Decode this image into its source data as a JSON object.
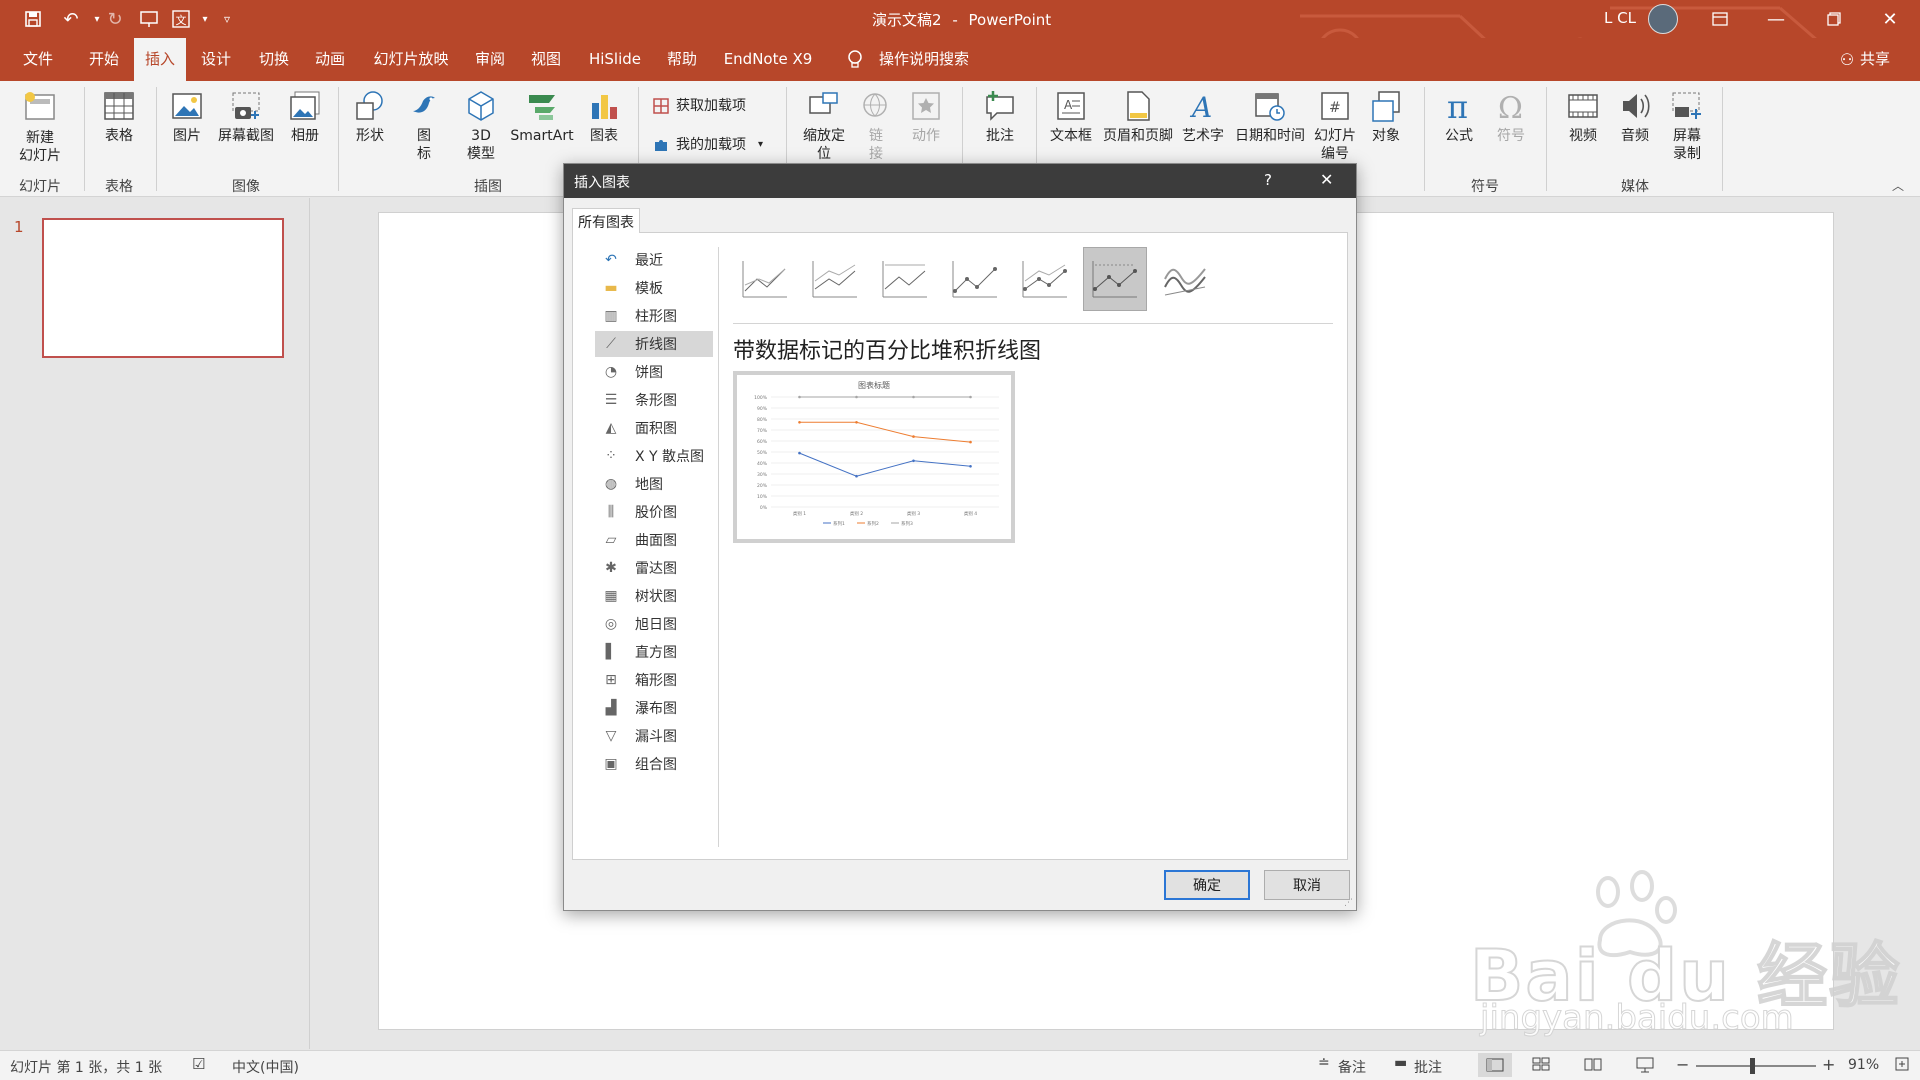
{
  "app": {
    "doc_title": "演示文稿2",
    "separator": "-",
    "app_name": "PowerPoint",
    "user": "L CL",
    "qat_icons": [
      "save-icon",
      "undo-icon",
      "redo-icon",
      "present-icon",
      "translate-icon",
      "customize-icon"
    ]
  },
  "tabs": [
    "文件",
    "开始",
    "插入",
    "设计",
    "切换",
    "动画",
    "幻灯片放映",
    "审阅",
    "视图",
    "HiSlide",
    "帮助",
    "EndNote X9"
  ],
  "active_tab": "插入",
  "tell_me": "操作说明搜索",
  "share": "共享",
  "ribbon": {
    "new_slide": [
      "新建",
      "幻灯片"
    ],
    "table": "表格",
    "picture": "图片",
    "screenshot": "屏幕截图",
    "album": "相册",
    "shape": "形状",
    "icon": [
      "图",
      "标"
    ],
    "model3d": [
      "3D",
      "模型"
    ],
    "smartart": "SmartArt",
    "chart": "图表",
    "get_addins": "获取加载项",
    "my_addins": "我的加载项",
    "zoom": [
      "缩放定",
      "位"
    ],
    "link": [
      "链",
      "接"
    ],
    "action": "动作",
    "comment": "批注",
    "textbox": "文本框",
    "header_footer": "页眉和页脚",
    "wordart": "艺术字",
    "datetime": "日期和时间",
    "slide_number": [
      "幻灯片",
      "编号"
    ],
    "object": "对象",
    "equation": "公式",
    "symbol": "符号",
    "video": "视频",
    "audio": "音频",
    "screen_record": [
      "屏幕",
      "录制"
    ],
    "groups": {
      "slides": "幻灯片",
      "tables": "表格",
      "images": "图像",
      "illustrations": "插图",
      "symbols": "符号",
      "media": "媒体"
    }
  },
  "slide_pane": {
    "slide_number": "1"
  },
  "dialog": {
    "title": "插入图表",
    "help": "?",
    "close": "✕",
    "tab": "所有图表",
    "categories": [
      "最近",
      "模板",
      "柱形图",
      "折线图",
      "饼图",
      "条形图",
      "面积图",
      "X Y 散点图",
      "地图",
      "股价图",
      "曲面图",
      "雷达图",
      "树状图",
      "旭日图",
      "直方图",
      "箱形图",
      "瀑布图",
      "漏斗图",
      "组合图"
    ],
    "selected_category": "折线图",
    "subtype_title": "带数据标记的百分比堆积折线图",
    "preview_chart_title": "图表标题",
    "ok": "确定",
    "cancel": "取消"
  },
  "chart_data": {
    "type": "line",
    "title": "图表标题",
    "categories": [
      "类别 1",
      "类别 2",
      "类别 3",
      "类别 4"
    ],
    "ytick_labels": [
      "0%",
      "10%",
      "20%",
      "30%",
      "40%",
      "50%",
      "60%",
      "70%",
      "80%",
      "90%",
      "100%"
    ],
    "ylim": [
      0,
      1
    ],
    "grid": true,
    "legend": "bottom",
    "series": [
      {
        "name": "系列1",
        "color": "#4472c4",
        "values": [
          0.49,
          0.28,
          0.42,
          0.37
        ]
      },
      {
        "name": "系列2",
        "color": "#ed7d31",
        "values": [
          0.77,
          0.77,
          0.64,
          0.59
        ]
      },
      {
        "name": "系列3",
        "color": "#a5a5a5",
        "values": [
          1.0,
          1.0,
          1.0,
          1.0
        ]
      }
    ]
  },
  "status": {
    "slide_info": "幻灯片 第 1 张，共 1 张",
    "language": "中文(中国)",
    "notes": "备注",
    "comments": "批注",
    "zoom": "91%"
  },
  "watermark": {
    "line1": "Bai du 经验",
    "line2": "jingyan.baidu.com"
  }
}
